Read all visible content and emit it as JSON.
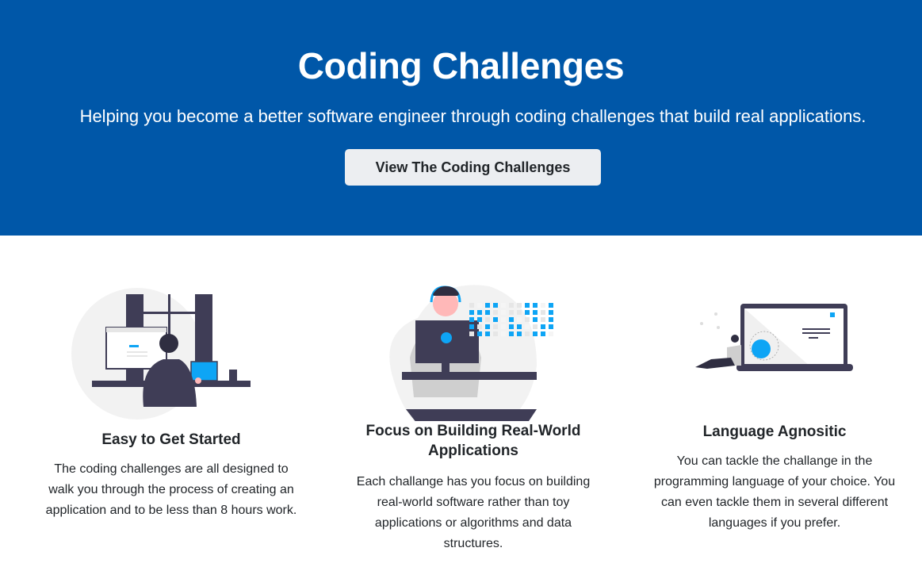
{
  "hero": {
    "title": "Coding Challenges",
    "subtitle": "Helping you become a better software engineer through coding challenges that build real applications.",
    "button_label": "View The Coding Challenges",
    "background_color": "#0057a8"
  },
  "features": [
    {
      "illustration": "developer-at-desk-illustration",
      "title": "Easy to Get Started",
      "body": "The coding challenges are all designed to walk you through the process of creating an application and to be less than 8 hours work."
    },
    {
      "illustration": "developer-with-headset-illustration",
      "title": "Focus on Building Real-World Applications",
      "body": "Each challange has you focus on building real-world software rather than toy applications or algorithms and data structures."
    },
    {
      "illustration": "person-with-laptop-illustration",
      "title": "Language Agnositic",
      "body": "You can tackle the challange in the programming language of your choice. You can even tackle them in several different languages if you prefer."
    }
  ],
  "colors": {
    "accent": "#0ea5f5",
    "dark": "#3f3d56"
  }
}
